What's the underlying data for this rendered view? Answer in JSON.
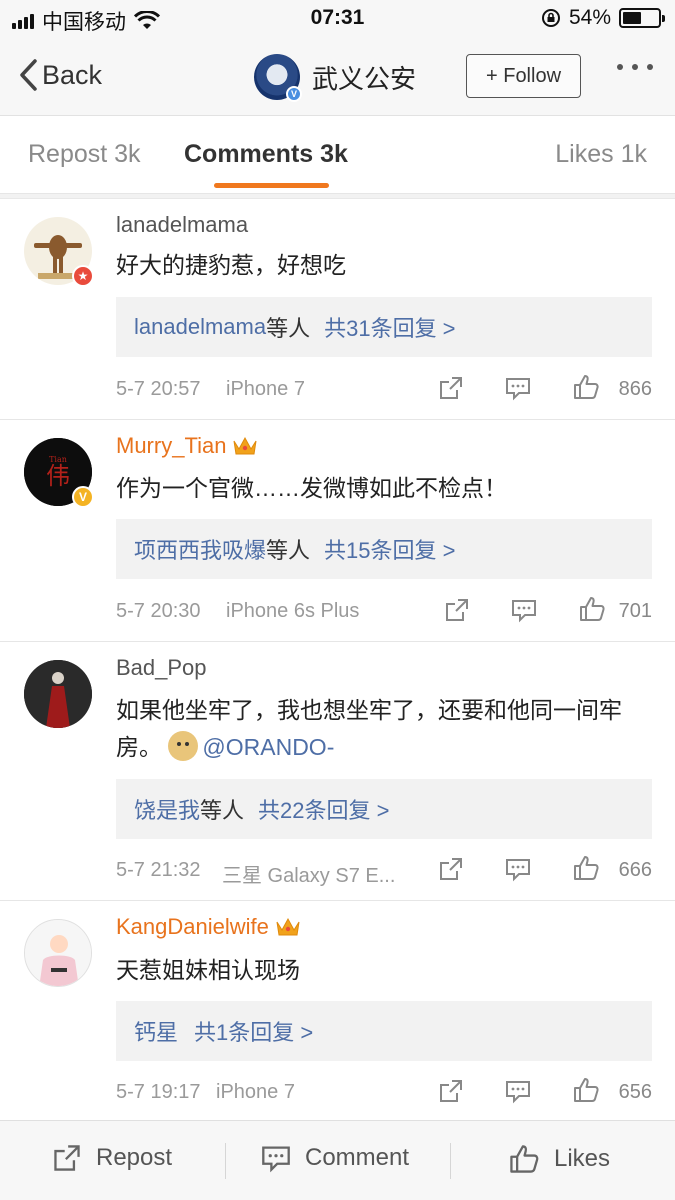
{
  "status_bar": {
    "carrier": "中国移动",
    "time": "07:31",
    "battery": "54%",
    "battery_level": 0.54
  },
  "nav": {
    "back_label": "Back",
    "title": "武义公安",
    "follow_label": "+ Follow"
  },
  "tabs": [
    {
      "label": "Repost 3k"
    },
    {
      "label": "Comments 3k"
    },
    {
      "label": "Likes 1k"
    }
  ],
  "comments": [
    {
      "user": "lanadelmama",
      "user_style": "regular",
      "text": "好大的捷豹惹，好想吃",
      "reply_users": "lanadelmama",
      "reply_suffix": "等人",
      "reply_count": "共31条回复 >",
      "date": "5-7 20:57",
      "device": "iPhone 7",
      "likes": "866"
    },
    {
      "user": "Murry_Tian",
      "user_style": "vip",
      "text": "作为一个官微……发微博如此不检点！",
      "reply_users": "项西西我吸爆",
      "reply_suffix": "等人",
      "reply_count": "共15条回复 >",
      "date": "5-7 20:30",
      "device": "iPhone 6s Plus",
      "likes": "701"
    },
    {
      "user": "Bad_Pop",
      "user_style": "regular",
      "text": "如果他坐牢了，我也想坐牢了，还要和他同一间牢房。",
      "mention": "@ORANDO-",
      "reply_users": "饶是我",
      "reply_suffix": "等人",
      "reply_count": "共22条回复 >",
      "date": "5-7 21:32",
      "device": "三星 Galaxy S7 E...",
      "likes": "666"
    },
    {
      "user": "KangDanielwife",
      "user_style": "vip",
      "text": "天惹姐妹相认现场",
      "reply_users": "钙星",
      "reply_suffix": "",
      "reply_count": "共1条回复 >",
      "date": "5-7 19:17",
      "device": "iPhone 7",
      "likes": "656"
    }
  ],
  "bottom_bar": {
    "repost_label": "Repost",
    "comment_label": "Comment",
    "likes_label": "Likes"
  },
  "colors": {
    "accent": "#f0781e",
    "link": "#4e6ea6",
    "vip_name": "#e8731d"
  },
  "icons": [
    "back-chevron-icon",
    "wifi-icon",
    "lock-rotation-icon",
    "battery-icon",
    "share-icon",
    "comment-icon",
    "thumbs-up-icon",
    "crown-icon"
  ]
}
